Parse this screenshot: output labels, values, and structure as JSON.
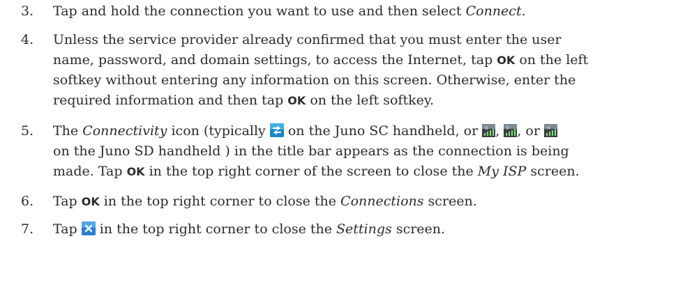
{
  "steps": [
    {
      "number": "3.",
      "lines": [
        [
          "Tap and hold the connection you want to use and then select ",
          "Connect",
          "."
        ]
      ]
    },
    {
      "number": "4.",
      "lines": [
        [
          "Unless the service provider already confirmed that you must enter the user"
        ],
        [
          "name, password, and domain settings, to access the Internet, tap ",
          "OK",
          " on the left"
        ],
        [
          "softkey without entering any information on this screen. Otherwise, enter the"
        ],
        [
          "required information and then tap ",
          "OK",
          " on the left softkey."
        ]
      ]
    },
    {
      "number": "5.",
      "lines": [
        [
          "The ",
          "Connectivity",
          " icon (typically ",
          " on the Juno SC handheld, or ",
          ", ",
          ", or "
        ],
        [
          "on the Juno SD handheld ) in the title bar appears as the connection is being"
        ],
        [
          "made. Tap ",
          "OK",
          " in the top right corner of the screen to close the ",
          "My ISP",
          " screen."
        ]
      ]
    },
    {
      "number": "6.",
      "lines": [
        [
          "Tap ",
          "OK",
          " in the top right corner to close the ",
          "Connections",
          " screen."
        ]
      ]
    },
    {
      "number": "7.",
      "lines": [
        [
          "Tap ",
          " in the top right corner to close the ",
          "Settings",
          " screen."
        ]
      ]
    }
  ],
  "icons": {
    "connectivity_sc": "connectivity-arrows-icon",
    "connectivity_sd_1": "signal-g-icon",
    "connectivity_sd_2": "signal-e-icon",
    "connectivity_sd_3": "signal-h-icon",
    "close": "close-x-icon"
  },
  "colors": {
    "text": "#2b2b2b",
    "icon_blue": "#1a78c2",
    "icon_teal": "#2a9a96",
    "close_blue": "#2f7fc9"
  }
}
